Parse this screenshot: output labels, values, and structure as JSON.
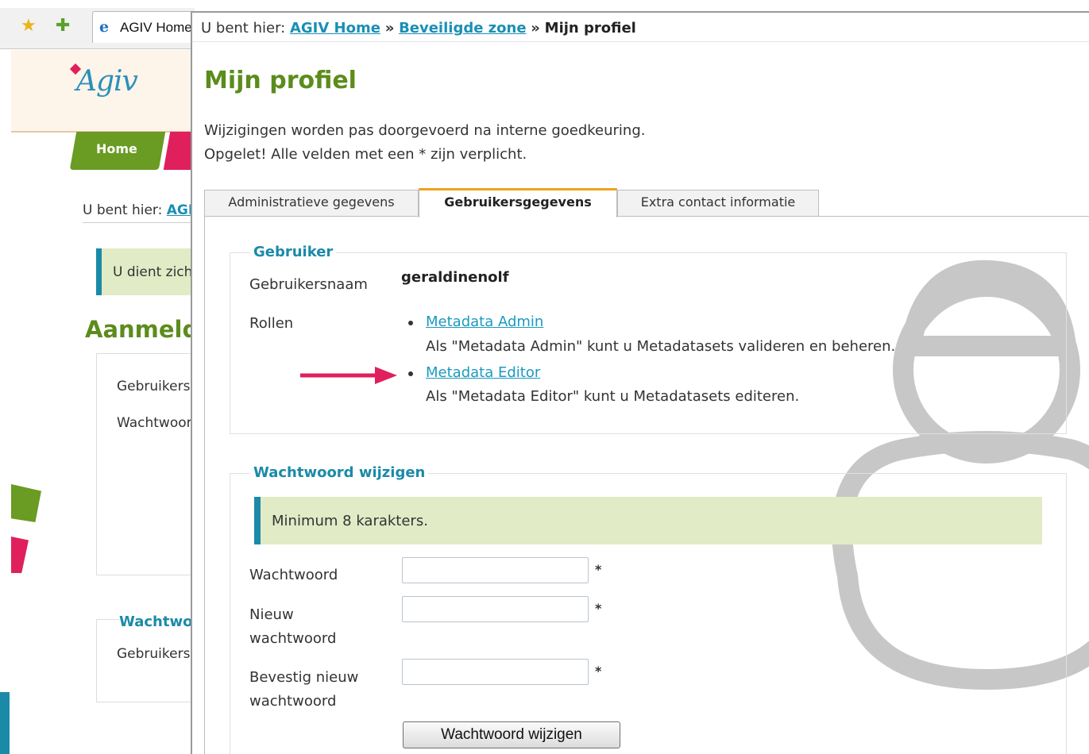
{
  "background_window": {
    "browser_tab_label": "AGIV Home",
    "logo_text": "Agiv",
    "home_tab_label": "Home",
    "breadcrumb_prefix": "U bent hier: ",
    "breadcrumb_link": "AGIV Home",
    "notice_text": "U dient zich aan te melden",
    "login_title": "Aanmelden",
    "login_fields": [
      "Gebruikersnaam",
      "Wachtwoord"
    ],
    "password_legend": "Wachtwoord vergeten",
    "password_field": "Gebruikersnaam"
  },
  "breadcrumb": {
    "prefix": "U bent hier:",
    "items": [
      "AGIV Home",
      "Beveiligde zone"
    ],
    "separator": "»",
    "current": "Mijn profiel"
  },
  "page": {
    "title": "Mijn profiel",
    "intro_lines": [
      "Wijzigingen worden pas doorgevoerd na interne goedkeuring.",
      "Opgelet! Alle velden met een * zijn verplicht."
    ]
  },
  "tabs": [
    {
      "label": "Administratieve gegevens",
      "active": false
    },
    {
      "label": "Gebruikersgegevens",
      "active": true
    },
    {
      "label": "Extra contact informatie",
      "active": false
    }
  ],
  "user_section": {
    "legend": "Gebruiker",
    "username_label": "Gebruikersnaam",
    "username_value": "geraldinenolf",
    "roles_label": "Rollen",
    "roles": [
      {
        "name": "Metadata Admin",
        "description": "Als \"Metadata Admin\" kunt u Metadatasets valideren en beheren."
      },
      {
        "name": "Metadata Editor",
        "description": "Als \"Metadata Editor\" kunt u Metadatasets editeren."
      }
    ]
  },
  "password_section": {
    "legend": "Wachtwoord wijzigen",
    "notice": "Minimum 8 karakters.",
    "fields": [
      {
        "label_lines": [
          "Wachtwoord"
        ],
        "value": "",
        "required_mark": "*"
      },
      {
        "label_lines": [
          "Nieuw",
          "wachtwoord"
        ],
        "value": "",
        "required_mark": "*"
      },
      {
        "label_lines": [
          "Bevestig nieuw",
          "wachtwoord"
        ],
        "value": "",
        "required_mark": "*"
      }
    ],
    "submit_label": "Wachtwoord wijzigen"
  },
  "colors": {
    "title_green": "#5c8c1c",
    "link_teal": "#1a8fb3",
    "notice_bg": "#e1ebc6",
    "notice_border": "#1b8aa8",
    "active_tab_accent": "#f0a020",
    "annotation_arrow": "#e0205c"
  },
  "icons": [
    "star-icon",
    "add-favorite-icon",
    "ie-icon",
    "avatar-watermark",
    "annotation-arrow"
  ]
}
